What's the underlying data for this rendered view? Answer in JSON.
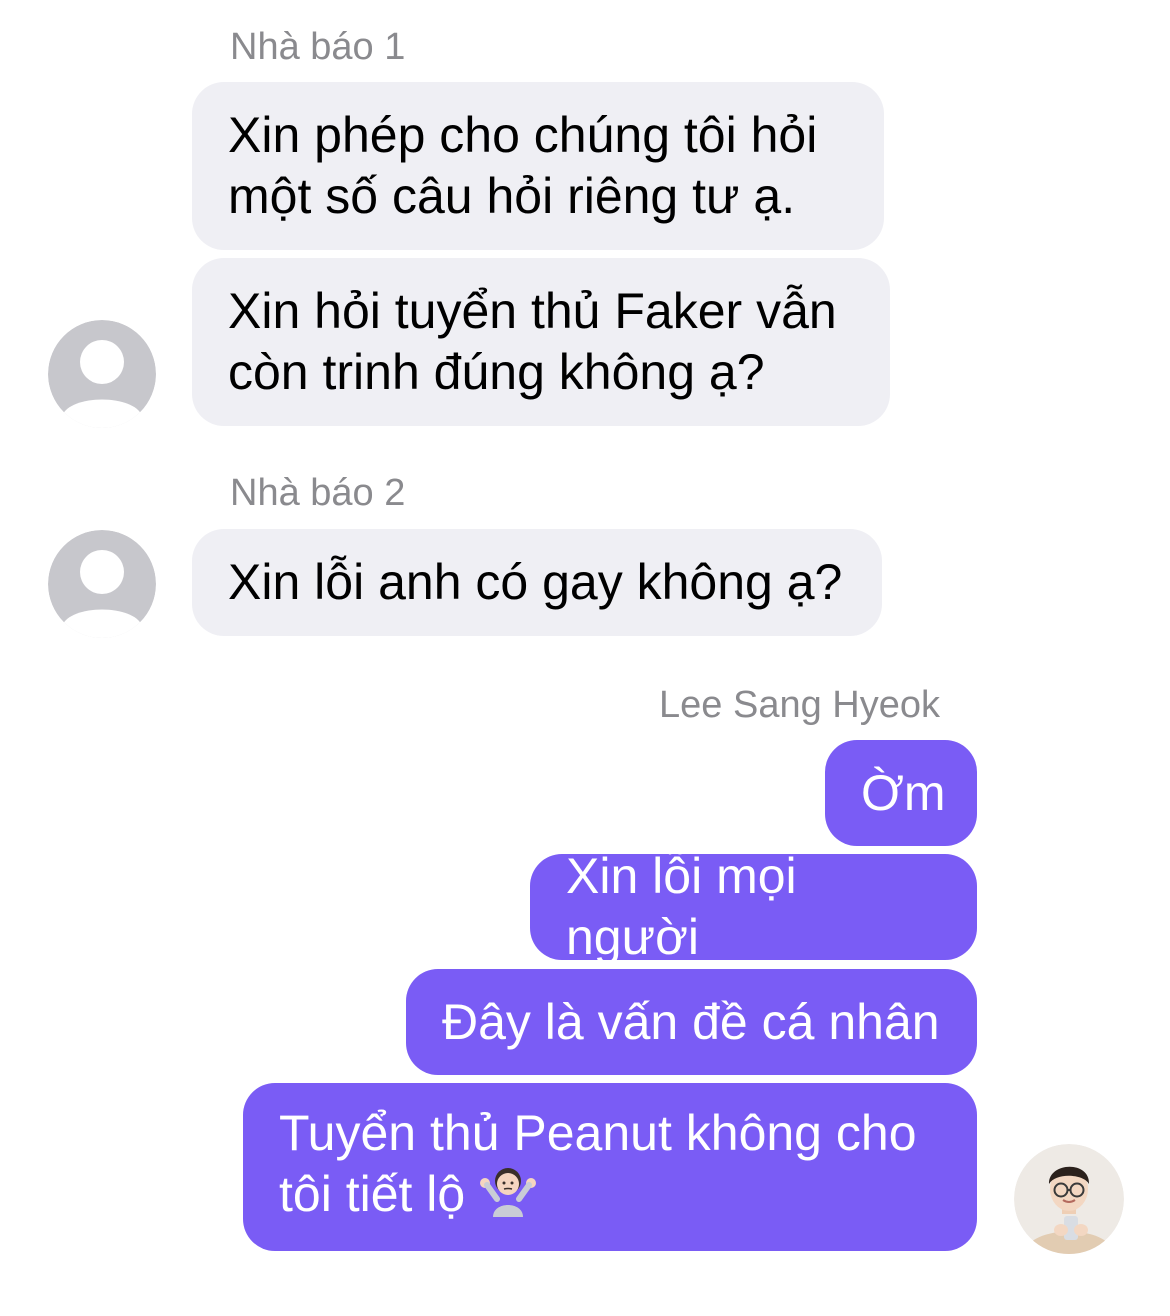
{
  "colors": {
    "incoming_bubble": "#efeff4",
    "outgoing_bubble": "#7a5cf5",
    "sender_name": "#8a8a8e",
    "placeholder_avatar": "#c7c7cc"
  },
  "groups": [
    {
      "sender": "Nhà báo 1",
      "messages": [
        {
          "line1": "Xin phép cho chúng tôi hỏi",
          "line2": "một số câu hỏi riêng tư ạ."
        },
        {
          "line1": "Xin hỏi tuyển thủ Faker vẫn",
          "line2": "còn trinh đúng không ạ?"
        }
      ],
      "avatar_icon": "default-person-icon"
    },
    {
      "sender": "Nhà báo 2",
      "messages": [
        {
          "line1": "Xin lỗi anh có gay không ạ?"
        }
      ],
      "avatar_icon": "default-person-icon"
    },
    {
      "sender": "Lee Sang Hyeok",
      "messages": [
        {
          "line1": "Ờm"
        },
        {
          "line1": "Xin lỗi mọi người"
        },
        {
          "line1": "Đây là vấn đề cá nhân"
        },
        {
          "line1": "Tuyển thủ Peanut không cho",
          "line2": "tôi tiết lộ",
          "emoji": "person-shrugging-emoji"
        }
      ],
      "avatar_icon": "profile-photo"
    }
  ]
}
